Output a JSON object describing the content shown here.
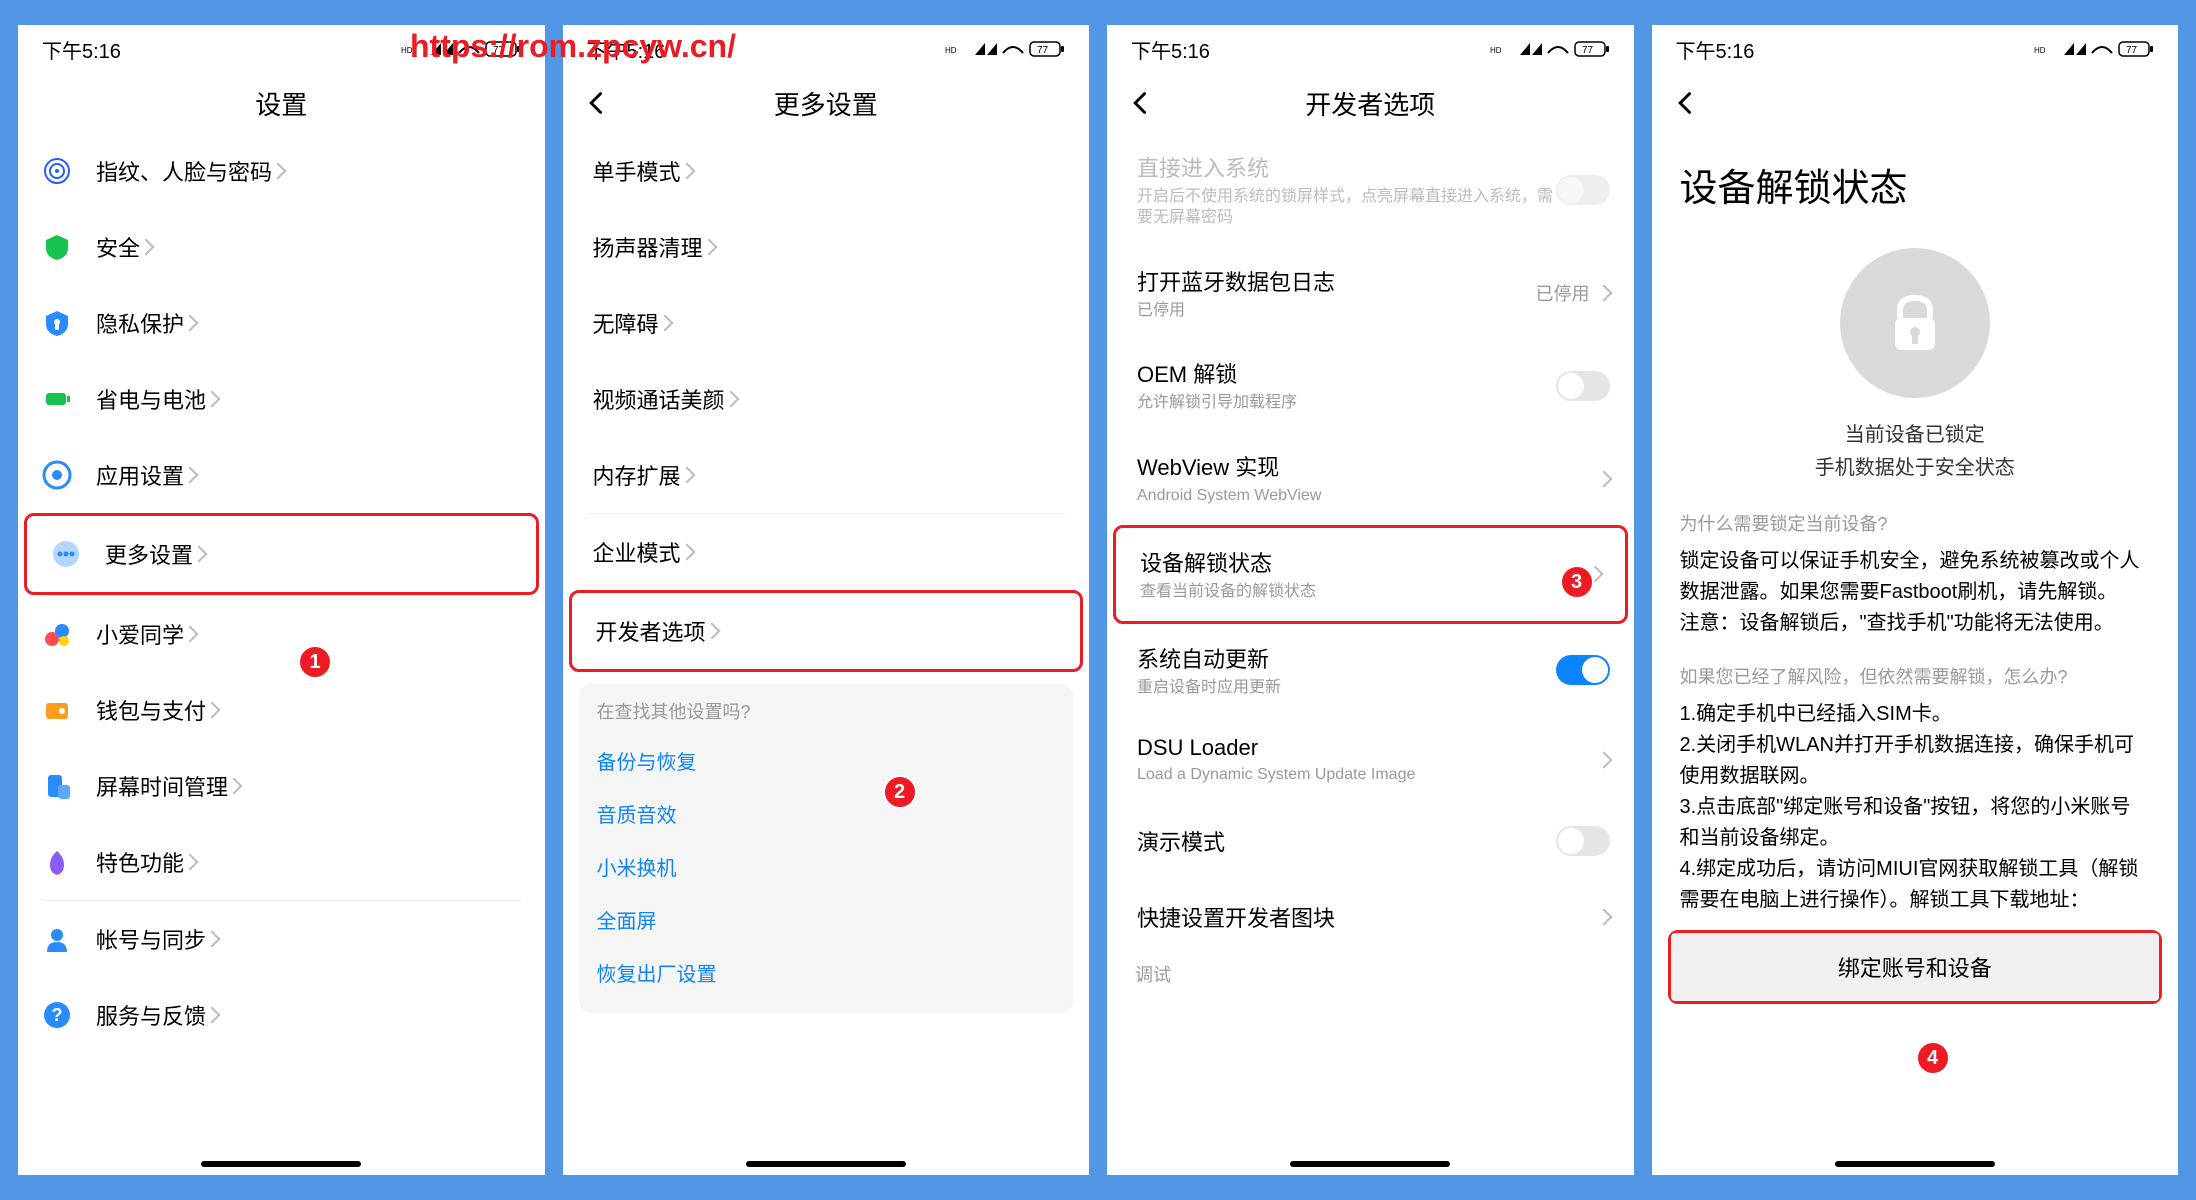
{
  "watermark": "https://rom.zpcyw.cn/",
  "status": {
    "time": "下午5:16",
    "battery": "77"
  },
  "screen1": {
    "title": "设置",
    "items": [
      {
        "icon": "fingerprint",
        "label": "指纹、人脸与密码",
        "color": "#2a5cff"
      },
      {
        "icon": "shield",
        "label": "安全",
        "color": "#17c24d"
      },
      {
        "icon": "privacy",
        "label": "隐私保护",
        "color": "#2a8bff"
      },
      {
        "icon": "battery",
        "label": "省电与电池",
        "color": "#17c24d"
      },
      {
        "icon": "apps",
        "label": "应用设置",
        "color": "#2a8bff"
      },
      {
        "icon": "more",
        "label": "更多设置",
        "color": "#2a8bff",
        "highlight": true
      }
    ],
    "group2": [
      {
        "icon": "xiaoai",
        "label": "小爱同学",
        "color": "#ff4d4d"
      },
      {
        "icon": "wallet",
        "label": "钱包与支付",
        "color": "#ff9b1e"
      },
      {
        "icon": "time",
        "label": "屏幕时间管理",
        "color": "#2a8bff"
      },
      {
        "icon": "special",
        "label": "特色功能",
        "color": "#8b5cf6"
      }
    ],
    "group3": [
      {
        "icon": "account",
        "label": "帐号与同步",
        "color": "#2a8bff"
      },
      {
        "icon": "help",
        "label": "服务与反馈",
        "color": "#2a8bff"
      }
    ],
    "step": "1"
  },
  "screen2": {
    "title": "更多设置",
    "items": [
      "单手模式",
      "扬声器清理",
      "无障碍",
      "视频通话美颜",
      "内存扩展",
      "企业模式",
      "开发者选项"
    ],
    "highlight_index": 6,
    "search_title": "在查找其他设置吗?",
    "search_links": [
      "备份与恢复",
      "音质音效",
      "小米换机",
      "全面屏",
      "恢复出厂设置"
    ],
    "step": "2"
  },
  "screen3": {
    "title": "开发者选项",
    "direct": {
      "title": "直接进入系统",
      "sub": "开启后不使用系统的锁屏样式，点亮屏幕直接进入系统，需要无屏幕密码"
    },
    "bluetooth": {
      "title": "打开蓝牙数据包日志",
      "sub": "已停用",
      "value": "已停用"
    },
    "oem": {
      "title": "OEM 解锁",
      "sub": "允许解锁引导加载程序"
    },
    "webview": {
      "title": "WebView 实现",
      "sub": "Android System WebView"
    },
    "unlock": {
      "title": "设备解锁状态",
      "sub": "查看当前设备的解锁状态",
      "highlight": true
    },
    "autoupdate": {
      "title": "系统自动更新",
      "sub": "重启设备时应用更新"
    },
    "dsu": {
      "title": "DSU Loader",
      "sub": "Load a Dynamic System Update Image"
    },
    "demo": {
      "title": "演示模式"
    },
    "quick": {
      "title": "快捷设置开发者图块"
    },
    "debuglabel": "调试",
    "step": "3"
  },
  "screen4": {
    "title": "设备解锁状态",
    "locked1": "当前设备已锁定",
    "locked2": "手机数据处于安全状态",
    "q1": "为什么需要锁定当前设备?",
    "a1": "锁定设备可以保证手机安全，避免系统被篡改或个人数据泄露。如果您需要Fastboot刷机，请先解锁。\n注意：设备解锁后，\"查找手机\"功能将无法使用。",
    "q2": "如果您已经了解风险，但依然需要解锁，怎么办?",
    "a2": "1.确定手机中已经插入SIM卡。\n2.关闭手机WLAN并打开手机数据连接，确保手机可使用数据联网。\n3.点击底部\"绑定账号和设备\"按钮，将您的小米账号和当前设备绑定。\n4.绑定成功后，请访问MIUI官网获取解锁工具（解锁需要在电脑上进行操作）。解锁工具下载地址：",
    "button": "绑定账号和设备",
    "step": "4"
  }
}
